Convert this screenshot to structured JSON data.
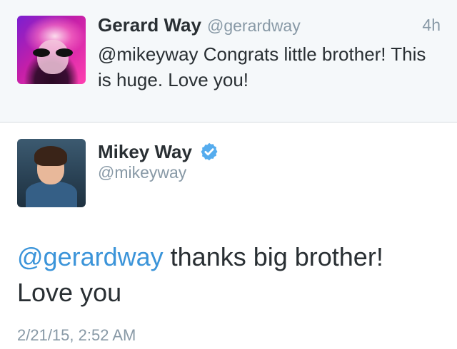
{
  "reply": {
    "name": "Gerard Way",
    "handle": "@gerardway",
    "time": "4h",
    "text": "@mikeyway Congrats little brother! This is huge. Love you!"
  },
  "main": {
    "name": "Mikey Way",
    "handle": "@mikeyway",
    "mention": "@gerardway",
    "text": " thanks big brother! Love you",
    "timestamp": "2/21/15, 2:52 AM",
    "verified_icon": "verified-badge",
    "verified_color": "#55acee"
  },
  "colors": {
    "link": "#3b94d9",
    "secondary_text": "#8899a6",
    "primary_text": "#292f33",
    "reply_background": "#f5f8fa"
  }
}
